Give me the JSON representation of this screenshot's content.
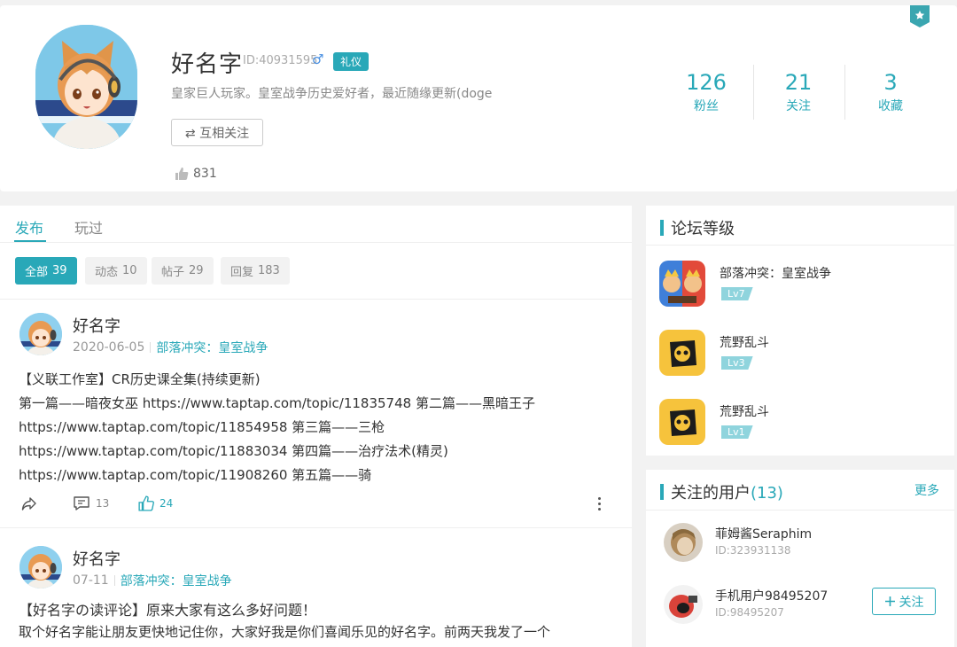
{
  "profile": {
    "name": "好名字",
    "id_text": "ID:40931595",
    "gender_symbol": "♂",
    "badge": "礼仪",
    "bio": "皇家巨人玩家。皇室战争历史爱好者，最近随缘更新(doge",
    "mutual_follow_label": "⇄ 互相关注",
    "likes": "831",
    "stats": [
      {
        "value": "126",
        "label": "粉丝"
      },
      {
        "value": "21",
        "label": "关注"
      },
      {
        "value": "3",
        "label": "收藏"
      }
    ]
  },
  "feed": {
    "tabs": [
      {
        "label": "发布"
      },
      {
        "label": "玩过"
      }
    ],
    "filters": [
      {
        "label": "全部",
        "count": "39"
      },
      {
        "label": "动态",
        "count": "10"
      },
      {
        "label": "帖子",
        "count": "29"
      },
      {
        "label": "回复",
        "count": "183"
      }
    ],
    "posts": [
      {
        "author": "好名字",
        "date": "2020-06-05",
        "game": "部落冲突：皇室战争",
        "lines": [
          "【义联工作室】CR历史课全集(持续更新)",
          "第一篇——暗夜女巫 https://www.taptap.com/topic/11835748 第二篇——黑暗王子",
          "https://www.taptap.com/topic/11854958 第三篇——三枪",
          "https://www.taptap.com/topic/11883034 第四篇——治疗法术(精灵)",
          "https://www.taptap.com/topic/11908260 第五篇——骑"
        ],
        "comments": "13",
        "likes": "24"
      },
      {
        "author": "好名字",
        "date": "07-11",
        "game": "部落冲突：皇室战争",
        "lines": [
          "【好名字の读评论】原来大家有这么多好问题！",
          "取个好名字能让朋友更快地记住你，大家好我是你们喜闻乐见的好名字。前两天我发了一个"
        ]
      }
    ]
  },
  "forum_level": {
    "title": "论坛等级",
    "games": [
      {
        "name": "部落冲突：皇室战争",
        "level": "Lv7",
        "icon": "clash-royale-icon"
      },
      {
        "name": "荒野乱斗",
        "level": "Lv3",
        "icon": "brawl-stars-icon"
      },
      {
        "name": "荒野乱斗",
        "level": "Lv1",
        "icon": "brawl-stars-icon"
      }
    ]
  },
  "followed_users": {
    "title": "关注的用户",
    "count": "(13)",
    "more": "更多",
    "users": [
      {
        "name": "菲姆酱Seraphim",
        "id": "ID:323931138"
      },
      {
        "name": "手机用户98495207",
        "id": "ID:98495207",
        "follow_label": "关注"
      }
    ]
  },
  "colors": {
    "accent": "#29a8b8",
    "background": "#f2f2f2",
    "level_tag": "#8fd4dd"
  }
}
